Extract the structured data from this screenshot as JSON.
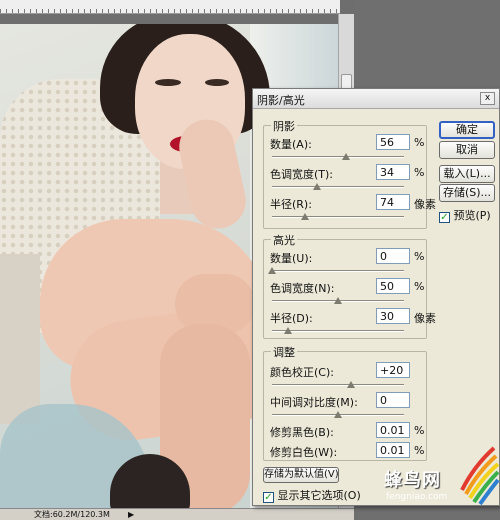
{
  "status": {
    "doc_info": "文档:60.2M/120.3M"
  },
  "dialog": {
    "title": "阴影/高光",
    "close_glyph": "x",
    "shadows": {
      "label": "阴影",
      "amount": {
        "label": "数量(A):",
        "value": "56",
        "unit": "%",
        "slider_fraction": 0.56
      },
      "tonal_width": {
        "label": "色调宽度(T):",
        "value": "34",
        "unit": "%",
        "slider_fraction": 0.34
      },
      "radius": {
        "label": "半径(R):",
        "value": "74",
        "unit": "像素",
        "slider_fraction": 0.25
      }
    },
    "highlights": {
      "label": "高光",
      "amount": {
        "label": "数量(U):",
        "value": "0",
        "unit": "%",
        "slider_fraction": 0.0
      },
      "tonal_width": {
        "label": "色调宽度(N):",
        "value": "50",
        "unit": "%",
        "slider_fraction": 0.5
      },
      "radius": {
        "label": "半径(D):",
        "value": "30",
        "unit": "像素",
        "slider_fraction": 0.12
      }
    },
    "adjustments": {
      "label": "调整",
      "color_correction": {
        "label": "颜色校正(C):",
        "value": "+20",
        "slider_fraction": 0.6
      },
      "midtone_contrast": {
        "label": "中间调对比度(M):",
        "value": "0",
        "slider_fraction": 0.5
      },
      "black_clip": {
        "label": "修剪黑色(B):",
        "value": "0.01",
        "unit": "%"
      },
      "white_clip": {
        "label": "修剪白色(W):",
        "value": "0.01",
        "unit": "%"
      }
    },
    "buttons": {
      "ok": "确定",
      "cancel": "取消",
      "load": "载入(L)...",
      "save": "存储(S)...",
      "save_default": "存储为默认值(V)"
    },
    "preview": {
      "label": "预览(P)",
      "checked": true
    },
    "show_more": {
      "label": "显示其它选项(O)",
      "checked": true
    }
  },
  "watermark": {
    "brand_cn": "蜂鸟网",
    "brand_en": "fengniao.com"
  },
  "colors": {
    "dialog_bg": "#ece9d8",
    "default_button_border": "#3360c4",
    "lips": "#b3132a"
  }
}
